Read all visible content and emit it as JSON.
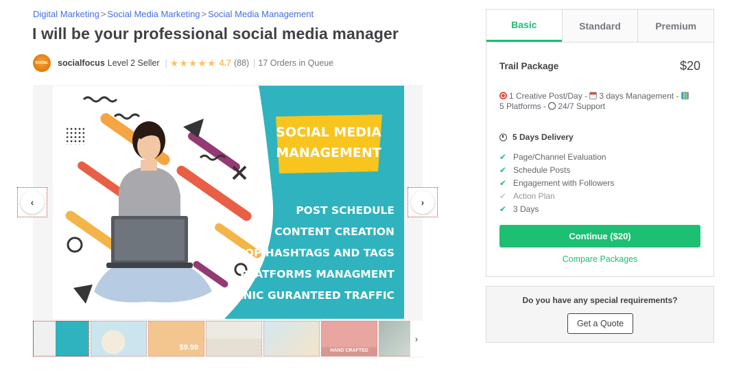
{
  "breadcrumb": {
    "items": [
      "Digital Marketing",
      "Social Media Marketing",
      "Social Media Management"
    ],
    "separator": ">"
  },
  "title": "I will be your professional social media manager",
  "seller": {
    "avatar_text": "SOCIAL",
    "name": "socialfocus",
    "level": "Level 2 Seller",
    "stars": "★★★★★",
    "rating": "4.7",
    "reviews": "(88)",
    "queue": "17 Orders in Queue",
    "divider": "|"
  },
  "gallery": {
    "prev_icon": "chevron-left-icon",
    "next_icon": "chevron-right-icon",
    "prev_glyph": "‹",
    "next_glyph": "›",
    "main_ad": {
      "headline_1": "SOCIAL MEDIA",
      "headline_2": "MANAGEMENT",
      "bullets": [
        "POST SCHEDULE",
        "CONTENT CREATION",
        "TOP HASHTAGS AND TAGS",
        "PLATFORMS MANAGMENT",
        "ORGANIC GURANTEED TRAFFIC"
      ]
    },
    "thumbnails": [
      {
        "color": "#2fb3be",
        "active": true
      },
      {
        "color": "#a9d8ea",
        "active": false
      },
      {
        "color": "#f2a03d",
        "active": false
      },
      {
        "color": "#e8e2d2",
        "active": false
      },
      {
        "color": "#b9dcec",
        "active": false
      },
      {
        "color": "#e0655a",
        "active": false
      },
      {
        "color": "#6c8a7a",
        "active": false
      }
    ],
    "thumb_arrow": "›",
    "thumb_texts": [
      "$9.99",
      "HAND CRAFTED"
    ]
  },
  "package": {
    "tabs": [
      "Basic",
      "Standard",
      "Premium"
    ],
    "active_tab": "Basic",
    "name": "Trail Package",
    "price": "$20",
    "description": {
      "part1": "1 Creative Post/Day - ",
      "part2": "3 days Management - ",
      "part3": "5 Platforms - ",
      "part4": "24/7 Support"
    },
    "delivery": "5 Days Delivery",
    "features": [
      {
        "label": "Page/Channel Evaluation",
        "included": true
      },
      {
        "label": "Schedule Posts",
        "included": true
      },
      {
        "label": "Engagement with Followers",
        "included": true
      },
      {
        "label": "Action Plan",
        "included": false
      },
      {
        "label": "3 Days",
        "included": true
      }
    ],
    "check_glyph": "✔",
    "continue_label": "Continue ($20)",
    "compare_label": "Compare Packages"
  },
  "quote": {
    "question": "Do you have any special requirements?",
    "button_label": "Get a Quote"
  },
  "colors": {
    "accent": "#1dbf73",
    "link": "#446ee7",
    "star": "#ffbe5b",
    "ad_teal": "#2fb3be",
    "ad_yellow": "#f7c51e"
  }
}
